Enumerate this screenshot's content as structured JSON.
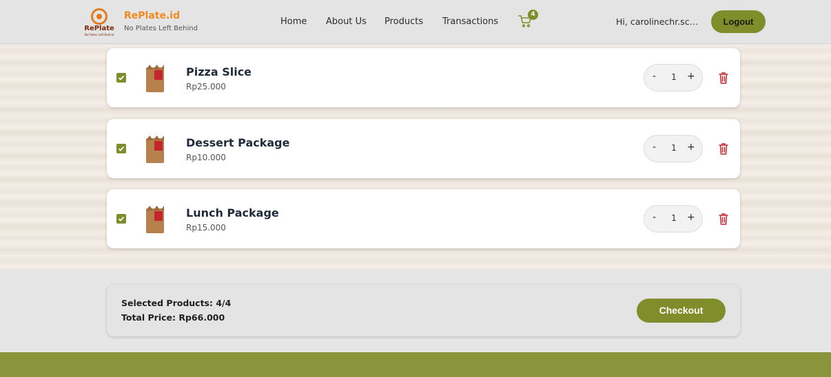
{
  "brand": {
    "logo_word": "RePlate",
    "logo_tagline": "No Plates Left Behind",
    "title": "RePlate.id",
    "subtitle": "No Plates Left Behind"
  },
  "nav": {
    "home": "Home",
    "about": "About Us",
    "products": "Products",
    "transactions": "Transactions"
  },
  "cart": {
    "count": "4"
  },
  "user": {
    "greeting": "Hi, carolinechr.sch...",
    "logout_label": "Logout"
  },
  "items": [
    {
      "name": "Pizza Slice",
      "price": "Rp25.000",
      "qty": "1",
      "checked": true
    },
    {
      "name": "Dessert Package",
      "price": "Rp10.000",
      "qty": "1",
      "checked": true
    },
    {
      "name": "Lunch Package",
      "price": "Rp15.000",
      "qty": "1",
      "checked": true
    }
  ],
  "qty_controls": {
    "minus": "-",
    "plus": "+"
  },
  "summary": {
    "selected": "Selected Products: 4/4",
    "total": "Total Price: Rp66.000",
    "checkout_label": "Checkout"
  },
  "colors": {
    "accent": "#7f8d2a",
    "brand_orange": "#f08a1c",
    "delete_red": "#c4262d",
    "footer": "#8a943a"
  }
}
